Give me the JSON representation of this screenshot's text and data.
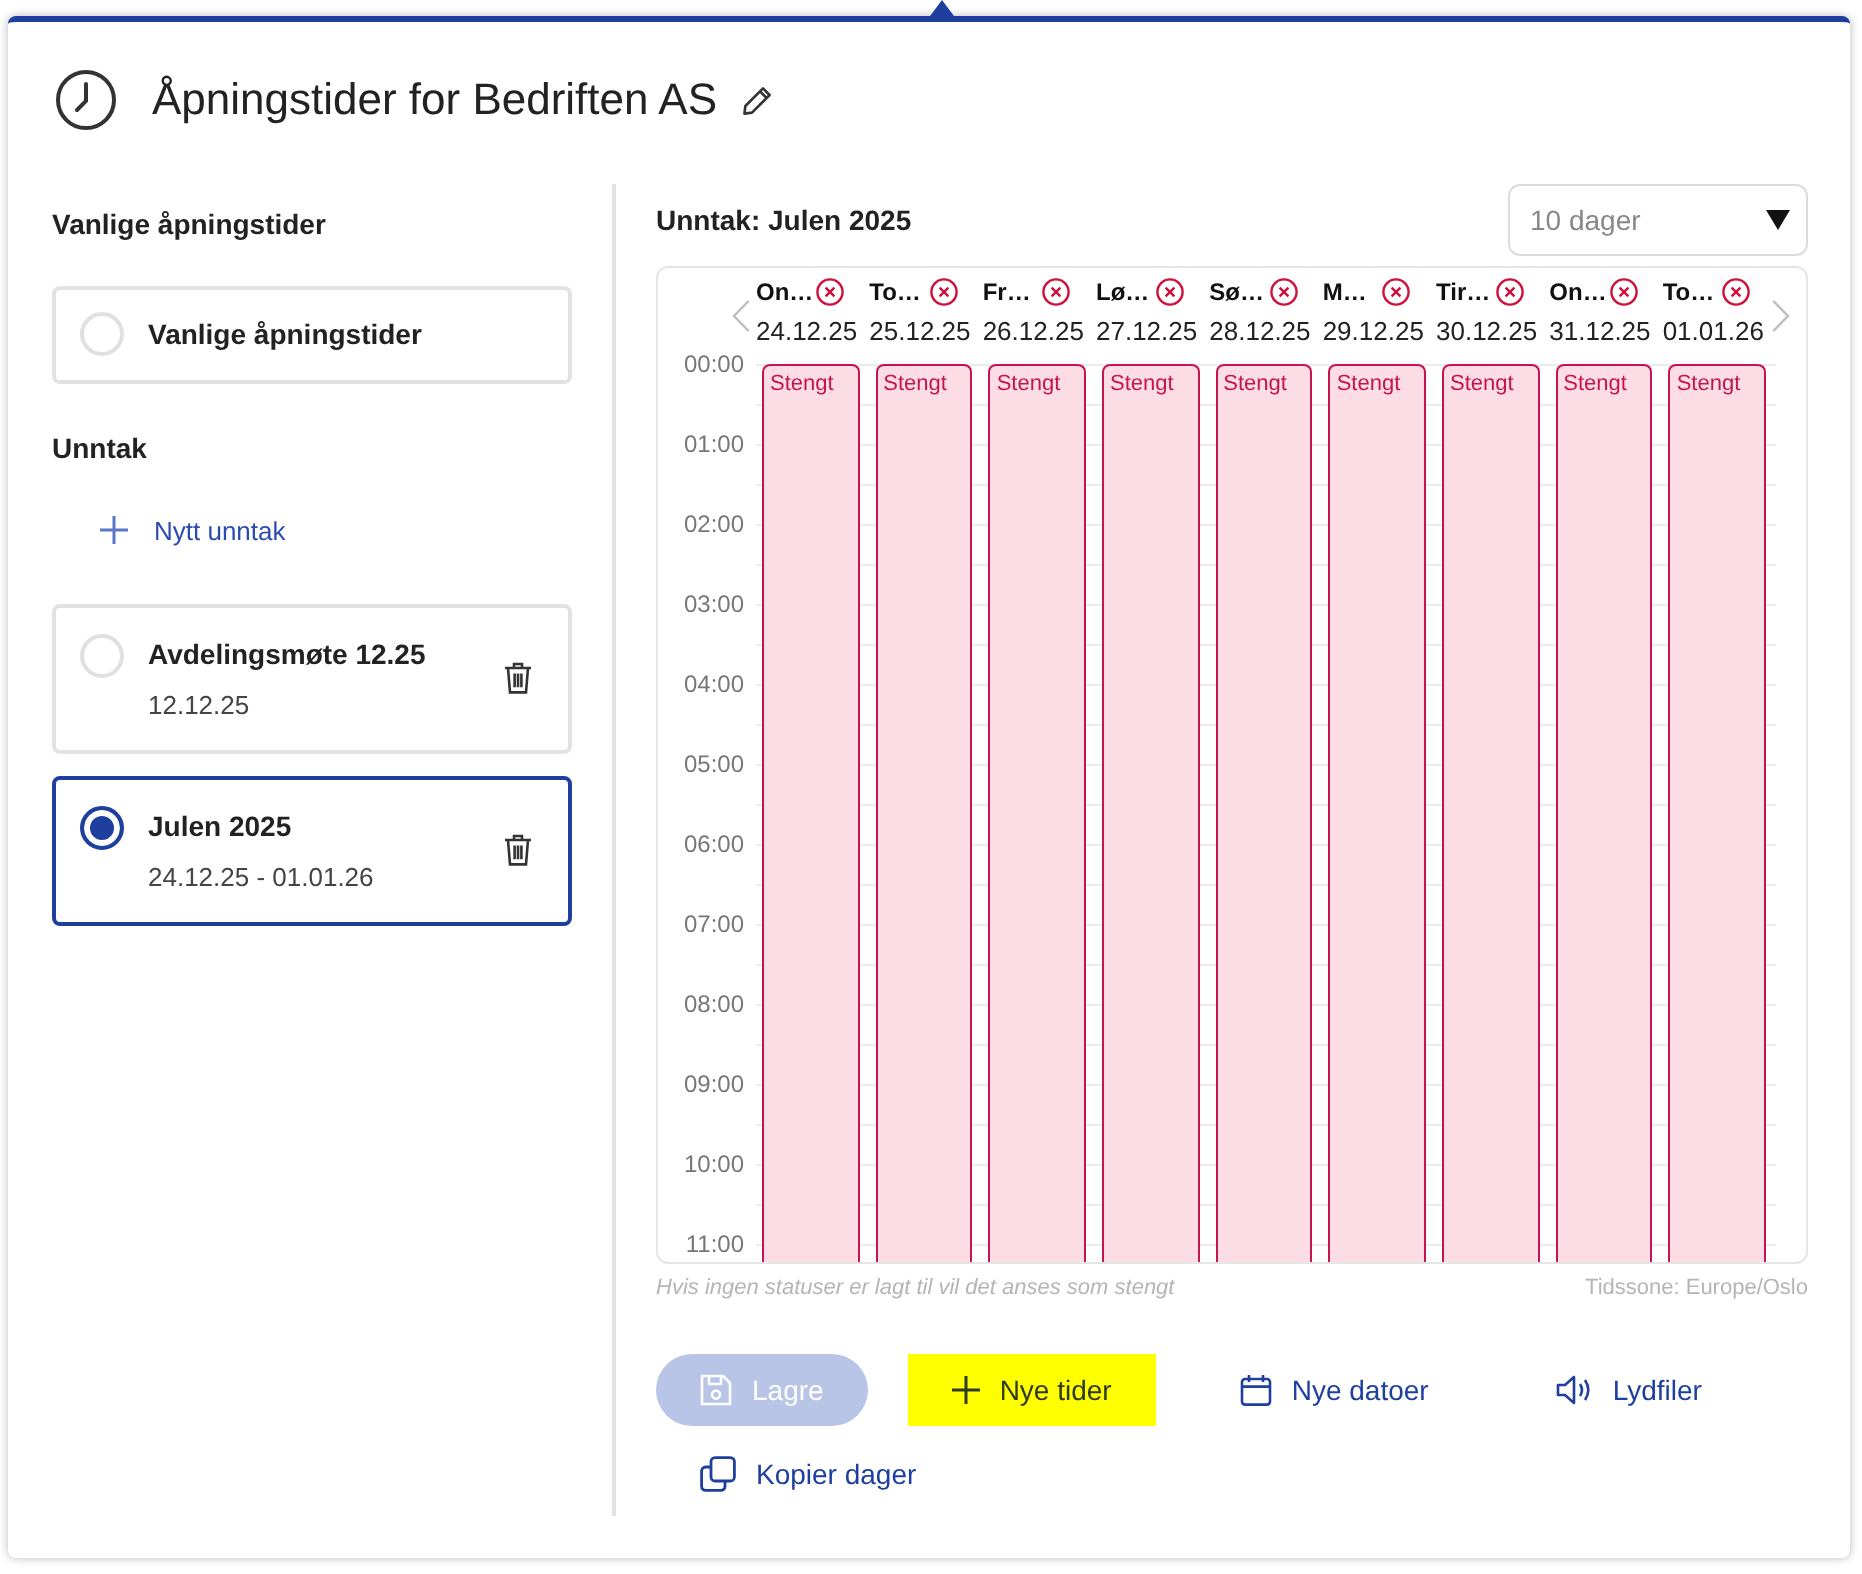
{
  "header": {
    "title": "Åpningstider for Bedriften AS"
  },
  "sidebar": {
    "regular_heading": "Vanlige åpningstider",
    "regular_option": {
      "label": "Vanlige åpningstider",
      "selected": false
    },
    "exceptions_heading": "Unntak",
    "new_exception": "Nytt unntak",
    "exceptions": [
      {
        "title": "Avdelingsmøte 12.25",
        "dates": "12.12.25",
        "selected": false
      },
      {
        "title": "Julen 2025",
        "dates": "24.12.25 - 01.01.26",
        "selected": true
      }
    ]
  },
  "calendar": {
    "title": "Unntak: Julen 2025",
    "range_select": {
      "value": "10 dager"
    },
    "days": [
      {
        "name": "On…",
        "date": "24.12.25",
        "status": "Stengt"
      },
      {
        "name": "To…",
        "date": "25.12.25",
        "status": "Stengt"
      },
      {
        "name": "Fr…",
        "date": "26.12.25",
        "status": "Stengt"
      },
      {
        "name": "Lø…",
        "date": "27.12.25",
        "status": "Stengt"
      },
      {
        "name": "Sø…",
        "date": "28.12.25",
        "status": "Stengt"
      },
      {
        "name": "M…",
        "date": "29.12.25",
        "status": "Stengt"
      },
      {
        "name": "Tir…",
        "date": "30.12.25",
        "status": "Stengt"
      },
      {
        "name": "On…",
        "date": "31.12.25",
        "status": "Stengt"
      },
      {
        "name": "To…",
        "date": "01.01.26",
        "status": "Stengt"
      }
    ],
    "hours": [
      "00:00",
      "01:00",
      "02:00",
      "03:00",
      "04:00",
      "05:00",
      "06:00",
      "07:00",
      "08:00",
      "09:00",
      "10:00",
      "11:00"
    ],
    "note": "Hvis ingen statuser er lagt til vil det anses som stengt",
    "timezone": "Tidssone: Europe/Oslo"
  },
  "actions": [
    {
      "kind": "save",
      "label": "Lagre",
      "disabled": true,
      "highlighted": false
    },
    {
      "kind": "add",
      "label": "Nye tider",
      "disabled": false,
      "highlighted": true
    },
    {
      "kind": "dates",
      "label": "Nye datoer",
      "disabled": false,
      "highlighted": false
    },
    {
      "kind": "audio",
      "label": "Lydfiler",
      "disabled": false,
      "highlighted": false
    },
    {
      "kind": "copy",
      "label": "Kopier dager",
      "disabled": false,
      "highlighted": false
    }
  ]
}
